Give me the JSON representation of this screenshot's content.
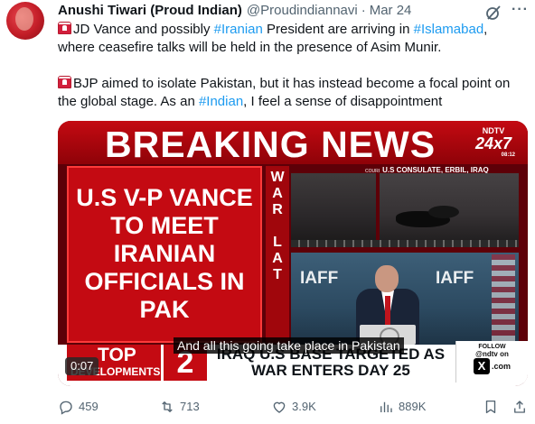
{
  "tweet": {
    "display_name": "Anushi Tiwari (Proud Indian)",
    "handle": "@Proudindiannavi",
    "separator": "·",
    "date": "Mar 24",
    "more_glyph": "···",
    "para1": {
      "t1": "JD Vance and possibly ",
      "h1": "#Iranian",
      "t2": " President are arriving in ",
      "h2": "#Islamabad",
      "t3": ",",
      "t4": "where ceasefire talks will be held in the presence of Asim Munir."
    },
    "para2": {
      "t1": "BJP aimed to isolate Pakistan, but it has instead become a focal point on",
      "t2": "the global stage. As an ",
      "h1": "#Indian",
      "t3": ", I feel a sense of disappointment"
    }
  },
  "video": {
    "banner": "BREAKING NEWS",
    "channel_top": "NDTV",
    "channel_name": "24x7",
    "clock": "08:12",
    "headline_line1": "U.S V-P VANCE",
    "headline_line2": "TO MEET",
    "headline_line3": "IRANIAN",
    "headline_line4": "OFFICIALS IN",
    "headline_line5": "PAK",
    "side_letters": [
      "W",
      "A",
      "R",
      "L",
      "A",
      "T"
    ],
    "location_source": "COURI",
    "location": "U.S CONSULATE, ERBIL, IRAQ",
    "podium_text": "IAFF",
    "caption": "And all this going take place in Pakistan",
    "ticker_tag_top": "TOP",
    "ticker_tag_bottom": "DEVELOPMENTS",
    "ticker_number": "2",
    "ticker_line1": "IRAQ U.S BASE TARGETED AS",
    "ticker_line2": "WAR ENTERS DAY 25",
    "follow_label": "FOLLOW",
    "follow_handle": "@ndtv on",
    "follow_x": "X",
    "follow_com": ".com",
    "timer": "0:07"
  },
  "actions": {
    "replies": "459",
    "reposts": "713",
    "likes": "3.9K",
    "views": "889K"
  },
  "colors": {
    "link": "#1d9bf0",
    "muted": "#536471",
    "news_red": "#c40a12"
  }
}
